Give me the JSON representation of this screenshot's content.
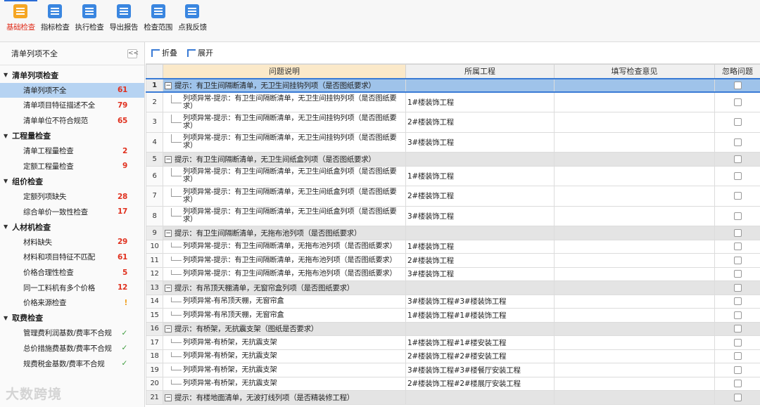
{
  "toolbar": [
    {
      "label": "基础检查",
      "icon": "basic-check-icon",
      "color": "#f5a623",
      "active": true
    },
    {
      "label": "指标检查",
      "icon": "index-check-icon",
      "color": "#3a86e0"
    },
    {
      "label": "执行检查",
      "icon": "run-check-icon",
      "color": "#3a86e0"
    },
    {
      "label": "导出报告",
      "icon": "export-report-icon",
      "color": "#3a86e0"
    },
    {
      "label": "检查范围",
      "icon": "check-scope-icon",
      "color": "#3a86e0"
    },
    {
      "label": "点我反馈",
      "icon": "feedback-icon",
      "color": "#3a86e0"
    }
  ],
  "left_title": "清单列项不全",
  "tree": [
    {
      "group": "清单列项检查",
      "items": [
        {
          "label": "清单列项不全",
          "count": "61",
          "type": "count",
          "selected": true
        },
        {
          "label": "清单项目特征描述不全",
          "count": "79",
          "type": "count"
        },
        {
          "label": "清单单位不符合规范",
          "count": "65",
          "type": "count"
        }
      ]
    },
    {
      "group": "工程量检查",
      "items": [
        {
          "label": "清单工程量检查",
          "count": "2",
          "type": "count"
        },
        {
          "label": "定额工程量检查",
          "count": "9",
          "type": "count"
        }
      ]
    },
    {
      "group": "组价检查",
      "items": [
        {
          "label": "定额列项缺失",
          "count": "28",
          "type": "count"
        },
        {
          "label": "综合单价一致性检查",
          "count": "17",
          "type": "count"
        }
      ]
    },
    {
      "group": "人材机检查",
      "items": [
        {
          "label": "材料缺失",
          "count": "29",
          "type": "count"
        },
        {
          "label": "材料和项目特征不匹配",
          "count": "61",
          "type": "count"
        },
        {
          "label": "价格合理性检查",
          "count": "5",
          "type": "count"
        },
        {
          "label": "同一工料机有多个价格",
          "count": "12",
          "type": "count"
        },
        {
          "label": "价格来源检查",
          "count": "!",
          "type": "warn"
        }
      ]
    },
    {
      "group": "取费检查",
      "items": [
        {
          "label": "管理费利润基数/费率不合规",
          "count": "✓",
          "type": "ok"
        },
        {
          "label": "总价措施费基数/费率不合规",
          "count": "✓",
          "type": "ok"
        },
        {
          "label": "规费税金基数/费率不合规",
          "count": "✓",
          "type": "ok"
        }
      ]
    }
  ],
  "watermark": "大数跨境",
  "subbar": {
    "collapse": "折叠",
    "expand": "展开"
  },
  "columns": [
    "问题说明",
    "所属工程",
    "填写检查意见",
    "忽略问题"
  ],
  "rows": [
    {
      "n": "1",
      "g": true,
      "desc": "提示：有卫生间隔断清单，无卫生间挂钩列项（是否图纸要求）",
      "proj": "",
      "sel": true
    },
    {
      "n": "2",
      "desc": "列项异常-提示：有卫生间隔断清单，无卫生间挂钩列项（是否图纸要求）",
      "proj": "1#楼装饰工程",
      "tall": true
    },
    {
      "n": "3",
      "desc": "列项异常-提示：有卫生间隔断清单，无卫生间挂钩列项（是否图纸要求）",
      "proj": "2#楼装饰工程",
      "tall": true
    },
    {
      "n": "4",
      "desc": "列项异常-提示：有卫生间隔断清单，无卫生间挂钩列项（是否图纸要求）",
      "proj": "3#楼装饰工程",
      "tall": true
    },
    {
      "n": "5",
      "g": true,
      "desc": "提示：有卫生间隔断清单，无卫生间纸盒列项（是否图纸要求）",
      "proj": ""
    },
    {
      "n": "6",
      "desc": "列项异常-提示：有卫生间隔断清单，无卫生间纸盒列项（是否图纸要求）",
      "proj": "1#楼装饰工程",
      "tall": true
    },
    {
      "n": "7",
      "desc": "列项异常-提示：有卫生间隔断清单，无卫生间纸盒列项（是否图纸要求）",
      "proj": "2#楼装饰工程",
      "tall": true
    },
    {
      "n": "8",
      "desc": "列项异常-提示：有卫生间隔断清单，无卫生间纸盒列项（是否图纸要求）",
      "proj": "3#楼装饰工程",
      "tall": true
    },
    {
      "n": "9",
      "g": true,
      "desc": "提示：有卫生间隔断清单，无拖布池列项（是否图纸要求）",
      "proj": ""
    },
    {
      "n": "10",
      "desc": "列项异常-提示：有卫生间隔断清单，无拖布池列项（是否图纸要求）",
      "proj": "1#楼装饰工程"
    },
    {
      "n": "11",
      "desc": "列项异常-提示：有卫生间隔断清单，无拖布池列项（是否图纸要求）",
      "proj": "2#楼装饰工程"
    },
    {
      "n": "12",
      "desc": "列项异常-提示：有卫生间隔断清单，无拖布池列项（是否图纸要求）",
      "proj": "3#楼装饰工程"
    },
    {
      "n": "13",
      "g": true,
      "desc": "提示：有吊顶天棚清单，无窗帘盒列项（是否图纸要求）",
      "proj": ""
    },
    {
      "n": "14",
      "desc": "列项异常-有吊顶天棚，无窗帘盒",
      "proj": "3#楼装饰工程#3#楼装饰工程"
    },
    {
      "n": "15",
      "desc": "列项异常-有吊顶天棚，无窗帘盒",
      "proj": "1#楼装饰工程#1#楼装饰工程"
    },
    {
      "n": "16",
      "g": true,
      "desc": "提示：有桥架，无抗震支架（图纸是否要求）",
      "proj": ""
    },
    {
      "n": "17",
      "desc": "列项异常-有桥架，无抗震支架",
      "proj": "1#楼装饰工程#1#楼安装工程"
    },
    {
      "n": "18",
      "desc": "列项异常-有桥架，无抗震支架",
      "proj": "2#楼装饰工程#2#楼安装工程"
    },
    {
      "n": "19",
      "desc": "列项异常-有桥架，无抗震支架",
      "proj": "3#楼装饰工程#3#楼餐厅安装工程"
    },
    {
      "n": "20",
      "desc": "列项异常-有桥架，无抗震支架",
      "proj": "2#楼装饰工程#2#楼展厅安装工程"
    },
    {
      "n": "21",
      "g": true,
      "desc": "提示：有楼地面清单，无波打线列项（是否精装修工程）",
      "proj": ""
    }
  ]
}
